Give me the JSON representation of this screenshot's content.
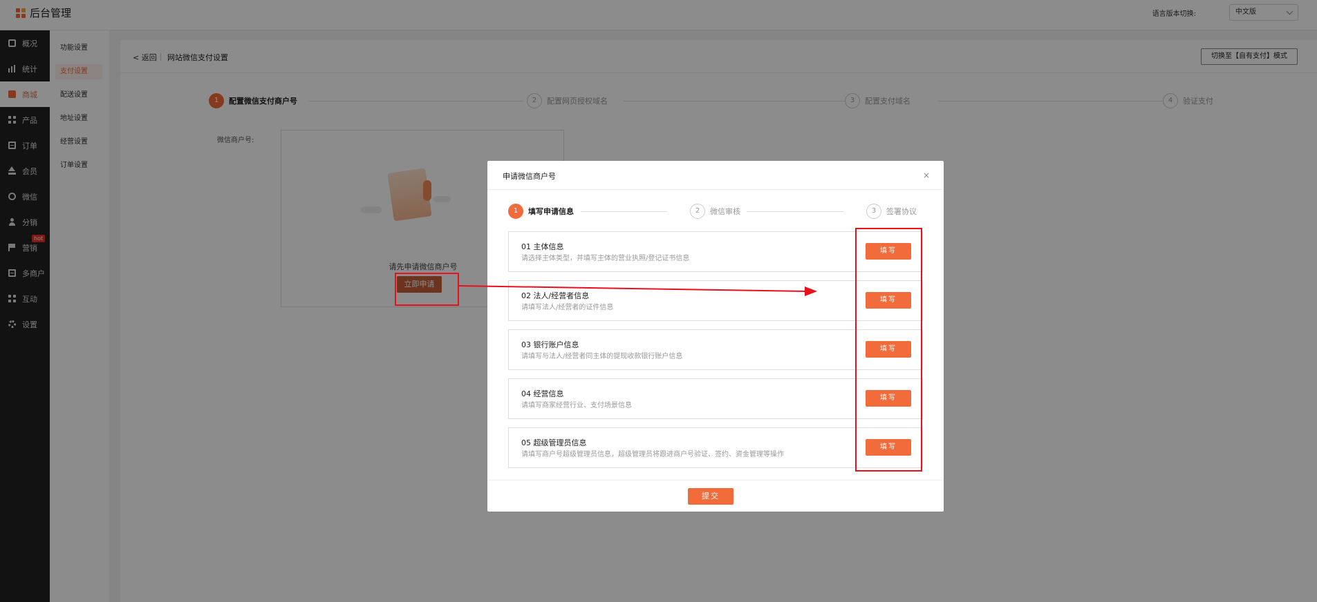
{
  "app": {
    "title": "后台管理"
  },
  "topbar": {
    "lang_label": "语言版本切换:",
    "lang_value": "中文版"
  },
  "sidebar": {
    "items": [
      {
        "label": "概况",
        "icon": "layers-icon"
      },
      {
        "label": "统计",
        "icon": "bar-chart-icon"
      },
      {
        "label": "商城",
        "icon": "shop-icon"
      },
      {
        "label": "产品",
        "icon": "grid-icon"
      },
      {
        "label": "订单",
        "icon": "clipboard-icon"
      },
      {
        "label": "会员",
        "icon": "crown-icon"
      },
      {
        "label": "微信",
        "icon": "wechat-icon"
      },
      {
        "label": "分销",
        "icon": "user-icon"
      },
      {
        "label": "营销",
        "icon": "flag-icon"
      },
      {
        "label": "多商户",
        "icon": "store-icon"
      },
      {
        "label": "互动",
        "icon": "apps-icon"
      },
      {
        "label": "设置",
        "icon": "gear-icon"
      }
    ],
    "hot_badge": "hot"
  },
  "subnav": {
    "items": [
      "功能设置",
      "支付设置",
      "配送设置",
      "地址设置",
      "经营设置",
      "订单设置"
    ]
  },
  "header": {
    "back": "< 返回",
    "title": "网站微信支付设置",
    "mode_button": "切换至【自有支付】模式"
  },
  "main_steps": [
    {
      "num": "1",
      "label": "配置微信支付商户号"
    },
    {
      "num": "2",
      "label": "配置网页授权域名"
    },
    {
      "num": "3",
      "label": "配置支付域名"
    },
    {
      "num": "4",
      "label": "验证支付"
    }
  ],
  "merchant": {
    "label": "微信商户号:",
    "empty_text": "请先申请微信商户号",
    "apply_button": "立即申请"
  },
  "modal": {
    "title": "申请微信商户号",
    "close": "×",
    "steps": [
      {
        "num": "1",
        "label": "填写申请信息"
      },
      {
        "num": "2",
        "label": "微信审核"
      },
      {
        "num": "3",
        "label": "签署协议"
      }
    ],
    "rows": [
      {
        "title": "01  主体信息",
        "desc": "请选择主体类型，并填写主体的营业执照/登记证书信息",
        "button": "填写"
      },
      {
        "title": "02  法人/经营者信息",
        "desc": "请填写法人/经营者的证件信息",
        "button": "填写"
      },
      {
        "title": "03  银行账户信息",
        "desc": "请填写与法人/经营者同主体的提现收款银行账户信息",
        "button": "填写"
      },
      {
        "title": "04  经营信息",
        "desc": "请填写商家经营行业、支付场景信息",
        "button": "填写"
      },
      {
        "title": "05  超级管理员信息",
        "desc": "请填写商户号超级管理员信息，超级管理员将跟进商户号验证、签约、资金管理等操作",
        "button": "填写"
      }
    ],
    "submit": "提交"
  },
  "colors": {
    "accent": "#f26b3a",
    "sidebar_bg": "#222222",
    "annotation_red": "#e8101a"
  }
}
